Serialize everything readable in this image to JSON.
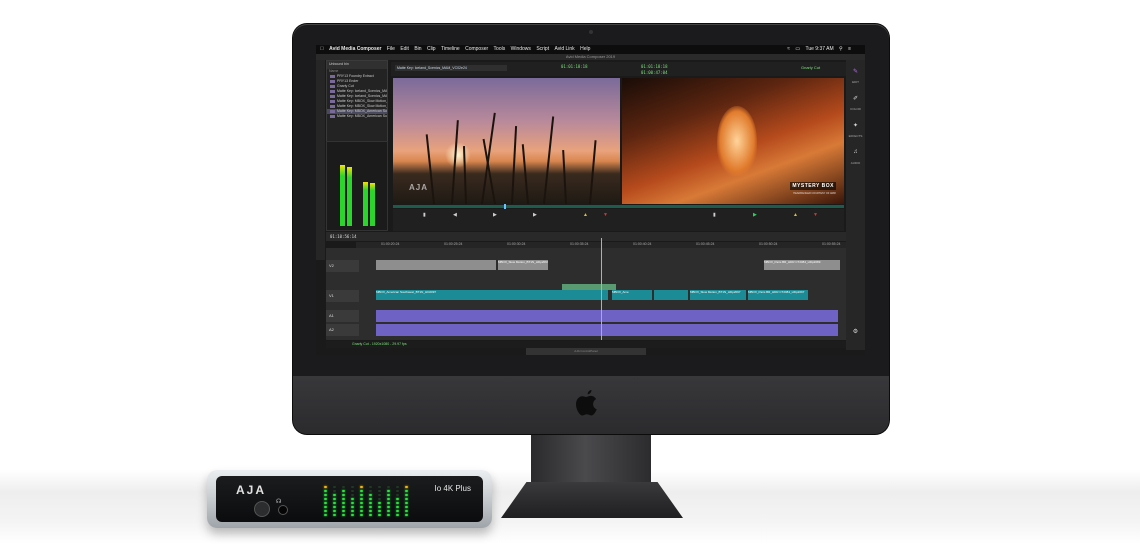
{
  "menubar": {
    "app": "Avid Media Composer",
    "items": [
      "File",
      "Edit",
      "Bin",
      "Clip",
      "Timeline",
      "Composer",
      "Tools",
      "Windows",
      "Script",
      "Avid Link",
      "Help"
    ],
    "clock": "Tue 9:37 AM"
  },
  "window_title": "Avid Media Composer 2019",
  "bin": {
    "title": "Unbound bin",
    "column_header": "Name",
    "items": [
      "PRY13 Foundry Extract",
      "PRY13 Ender",
      "Gnarly Cut",
      "Matte Key: Iceland_Scenics_MAM_VC",
      "Matte Key: Iceland_Scenics_MAM_Dr",
      "Matte Key: MBOX_Slow Motion_BT3",
      "Matte Key: MBOX_Slow Motion_BT1",
      "Matte Key: MBOX_American Southwe",
      "Matte Key: MBOX_American Southwe"
    ],
    "selected_index": 7,
    "meter_levels": [
      0.8,
      0.77,
      0.58,
      0.57
    ]
  },
  "viewer": {
    "source_clip": "Matte Key: Iceland_Scenics_MAM_VC02e24",
    "source_tc": "01:01:18:18",
    "master_tc": "01:01:18:18",
    "record_tc": "01:00:47:04",
    "sequence_name": "Gnarly Cut",
    "source_watermark": "AJA",
    "record_title": "MYSTERY BOX",
    "record_subtitle": "HEADBANGER COURTESY OF ARRI"
  },
  "tools": [
    {
      "icon": "edit-icon",
      "label": "EDIT"
    },
    {
      "icon": "color-icon",
      "label": "COLOR"
    },
    {
      "icon": "effects-icon",
      "label": "EFFECTS"
    },
    {
      "icon": "audio-icon",
      "label": "AUDIO"
    }
  ],
  "timeline": {
    "position_tc": "01:10:56:14",
    "ruler": [
      "01:00:20:24",
      "01:00:25:24",
      "01:00:30:24",
      "01:00:35:24",
      "01:00:40:24",
      "01:00:45:24",
      "01:00:50:24",
      "01:00:55:24"
    ],
    "track_names": [
      "V2",
      "V1",
      "A1",
      "A2"
    ],
    "clips": [
      {
        "name": "MBOX_Slow Motion_BT1N_HDp2097",
        "track": "V2"
      },
      {
        "name": "MBOX_Paris BR_HDR CT2084_HDp2089",
        "track": "V2"
      },
      {
        "name": "MBOX_American Southwest_BT1N_HD2097",
        "track": "V1"
      },
      {
        "name": "MBOX_Ame",
        "track": "V1"
      },
      {
        "name": "MBOX_Slow Motion_BT1N_HDp2097",
        "track": "V1"
      },
      {
        "name": "MBOX_Paris BR_HDR CT2084_HDp2097",
        "track": "V1"
      }
    ],
    "status": "Gnarly Cut - 1920x1080 - 29.97 fps"
  },
  "dock_label": "AJA ControlPanel",
  "device": {
    "brand": "AJA",
    "model": "Io 4K Plus"
  },
  "colors": {
    "accent_purple": "#8a4fbf",
    "meter_green": "#2bd52b",
    "timeline_teal": "#1b8c96",
    "audio_clip": "#6e63c4"
  }
}
